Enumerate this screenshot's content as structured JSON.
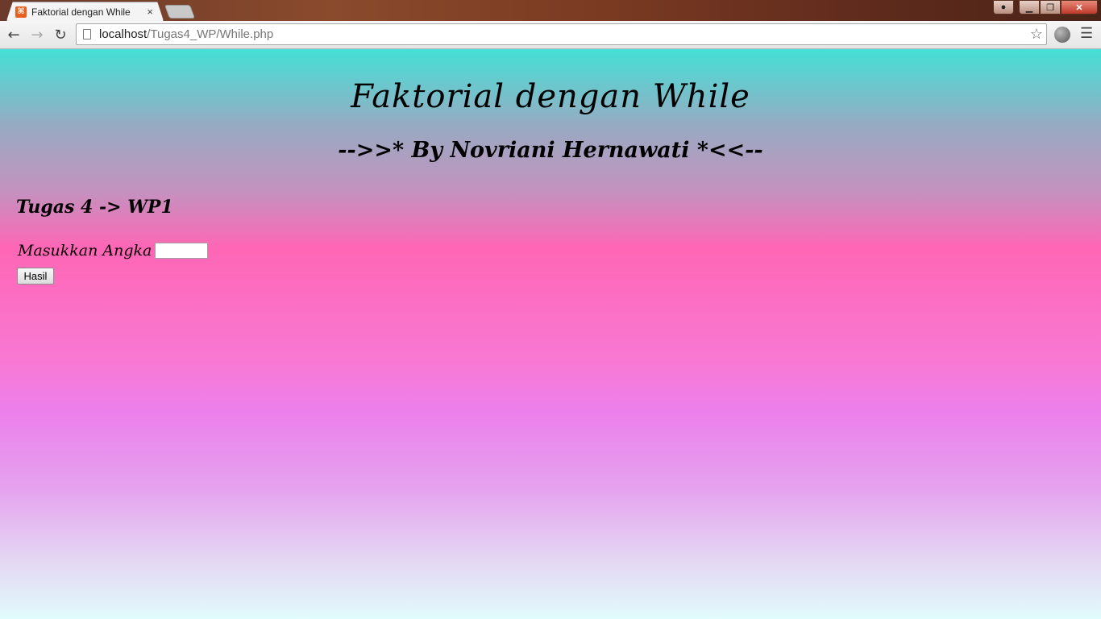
{
  "browser": {
    "tab_title": "Faktorial dengan While",
    "tab_close": "×",
    "url_host": "localhost",
    "url_path": "/Tugas4_WP/While.php",
    "back_icon": "←",
    "forward_icon": "→",
    "reload_icon": "↻",
    "star_icon": "☆",
    "menu_icon": "☰",
    "close_label": "✕"
  },
  "page": {
    "title": "Faktorial dengan While",
    "subtitle": "-->>* By Novriani Hernawati *<<--",
    "heading": "Tugas 4 -> WP1",
    "form": {
      "label": "Masukkan Angka",
      "input_value": "",
      "submit_label": "Hasil"
    }
  },
  "colors": {
    "gradient_top": "#45e0d6",
    "gradient_mid": "#ff66b5",
    "gradient_bottom": "#e1fbfc"
  }
}
